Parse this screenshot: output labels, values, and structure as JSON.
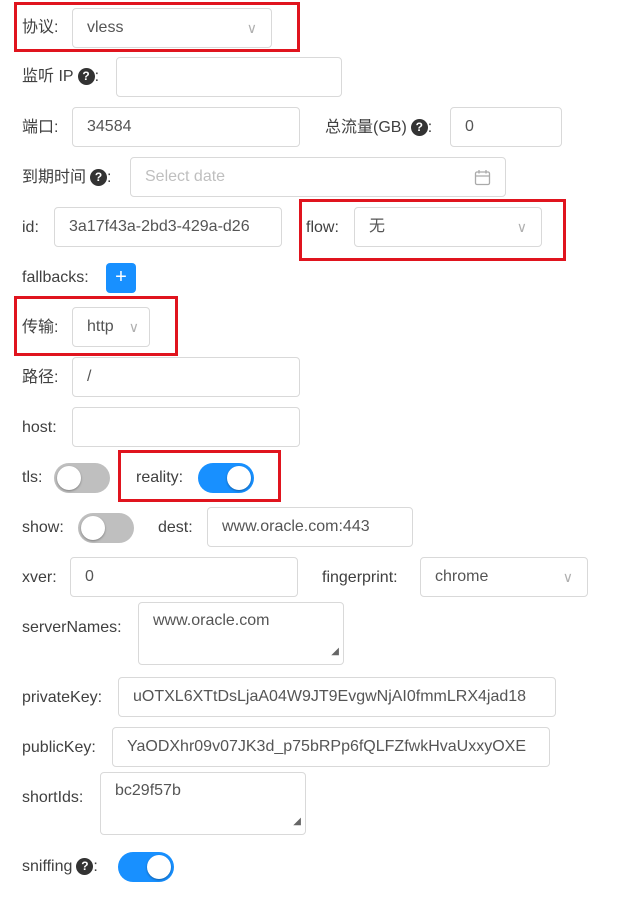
{
  "protocol": {
    "label": "协议:",
    "value": "vless"
  },
  "listen_ip": {
    "label": "监听 IP",
    "colon": ":",
    "value": ""
  },
  "port": {
    "label": "端口:",
    "value": "34584"
  },
  "total_traffic": {
    "label": "总流量(GB)",
    "colon": ":",
    "value": "0"
  },
  "expiry": {
    "label": "到期时间",
    "colon": ":",
    "placeholder": "Select date"
  },
  "id": {
    "label": "id:",
    "value": "3a17f43a-2bd3-429a-d26"
  },
  "flow": {
    "label": "flow:",
    "value": "无"
  },
  "fallbacks": {
    "label": "fallbacks:",
    "add": "+"
  },
  "transport": {
    "label": "传输:",
    "value": "http"
  },
  "path": {
    "label": "路径:",
    "value": "/"
  },
  "host": {
    "label": "host:",
    "value": ""
  },
  "tls": {
    "label": "tls:",
    "on": false
  },
  "reality": {
    "label": "reality:",
    "on": true
  },
  "show": {
    "label": "show:",
    "on": false
  },
  "dest": {
    "label": "dest:",
    "value": "www.oracle.com:443"
  },
  "xver": {
    "label": "xver:",
    "value": "0"
  },
  "fingerprint": {
    "label": "fingerprint:",
    "value": "chrome"
  },
  "server_names": {
    "label": "serverNames:",
    "value": "www.oracle.com"
  },
  "private_key": {
    "label": "privateKey:",
    "value": "uOTXL6XTtDsLjaA04W9JT9EvgwNjAI0fmmLRX4jad18"
  },
  "public_key": {
    "label": "publicKey:",
    "value": "YaODXhr09v07JK3d_p75bRPp6fQLFZfwkHvaUxxyOXE"
  },
  "short_ids": {
    "label": "shortIds:",
    "value": "bc29f57b"
  },
  "sniffing": {
    "label": "sniffing",
    "colon": ":",
    "on": true
  },
  "icons": {
    "help": "?",
    "chevron": "∨",
    "calendar": "calendar-icon"
  },
  "colors": {
    "accent": "#1890ff",
    "highlight": "#e0141e"
  }
}
